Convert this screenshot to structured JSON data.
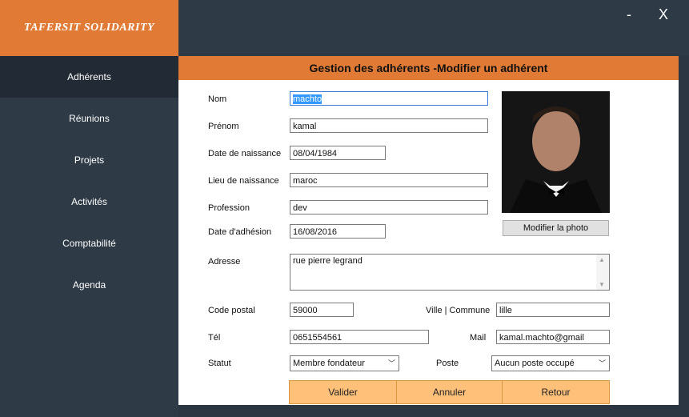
{
  "app": {
    "brand": "TAFERSIT SOLIDARITY",
    "minimize": "-",
    "close": "X"
  },
  "sidebar": {
    "items": [
      {
        "label": "Adhérents"
      },
      {
        "label": "Réunions"
      },
      {
        "label": "Projets"
      },
      {
        "label": "Activités"
      },
      {
        "label": "Comptabilité"
      },
      {
        "label": "Agenda"
      }
    ]
  },
  "page": {
    "title": "Gestion des adhérents -Modifier un adhérent"
  },
  "form": {
    "nom": {
      "label": "Nom",
      "value": "machto"
    },
    "prenom": {
      "label": "Prénom",
      "value": "kamal"
    },
    "date_naissance": {
      "label": "Date de naissance",
      "value": "08/04/1984"
    },
    "lieu_naissance": {
      "label": "Lieu de naissance",
      "value": "maroc"
    },
    "profession": {
      "label": "Profession",
      "value": "dev"
    },
    "date_adhesion": {
      "label": "Date d'adhésion",
      "value": "16/08/2016"
    },
    "adresse": {
      "label": "Adresse",
      "value": "rue pierre legrand"
    },
    "code_postal": {
      "label": "Code postal",
      "value": "59000"
    },
    "ville": {
      "label": "Ville | Commune",
      "value": "lille"
    },
    "tel": {
      "label": "Tél",
      "value": "0651554561"
    },
    "mail": {
      "label": "Mail",
      "value": "kamal.machto@gmail"
    },
    "statut": {
      "label": "Statut",
      "value": "Membre fondateur"
    },
    "poste": {
      "label": "Poste",
      "value": "Aucun poste occupé"
    }
  },
  "photo": {
    "button": "Modifier la photo"
  },
  "actions": {
    "valider": "Valider",
    "annuler": "Annuler",
    "retour": "Retour"
  }
}
